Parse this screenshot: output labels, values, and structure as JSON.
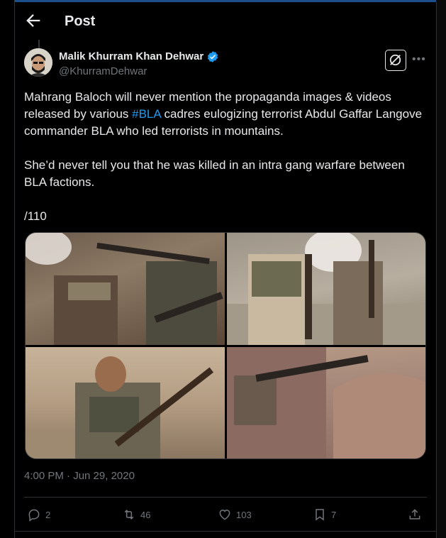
{
  "header": {
    "title": "Post"
  },
  "author": {
    "name": "Malik Khurram Khan Dehwar",
    "handle": "@KhurramDehwar",
    "verified": true
  },
  "post": {
    "text_para1_before": "Mahrang Baloch will never mention the propaganda images & videos released by various ",
    "hashtag": "#BLA",
    "text_para1_after": " cadres eulogizing terrorist Abdul Gaffar Langove commander BLA who led terrorists in mountains.",
    "text_para2": "She’d never tell you that he was killed in an intra gang warfare between BLA factions.",
    "text_para3": "/110",
    "timestamp": "4:00 PM · Jun 29, 2020"
  },
  "stats": {
    "replies": "2",
    "reposts": "46",
    "likes": "103",
    "bookmarks": "7"
  },
  "colors": {
    "background": "#000000",
    "text": "#e7e9ea",
    "muted": "#71767b",
    "accent": "#1d9bf0",
    "border": "#2f3336"
  },
  "icons": [
    "back-arrow-icon",
    "verified-badge-icon",
    "grok-icon",
    "more-icon",
    "reply-icon",
    "repost-icon",
    "like-icon",
    "bookmark-icon",
    "share-icon"
  ]
}
